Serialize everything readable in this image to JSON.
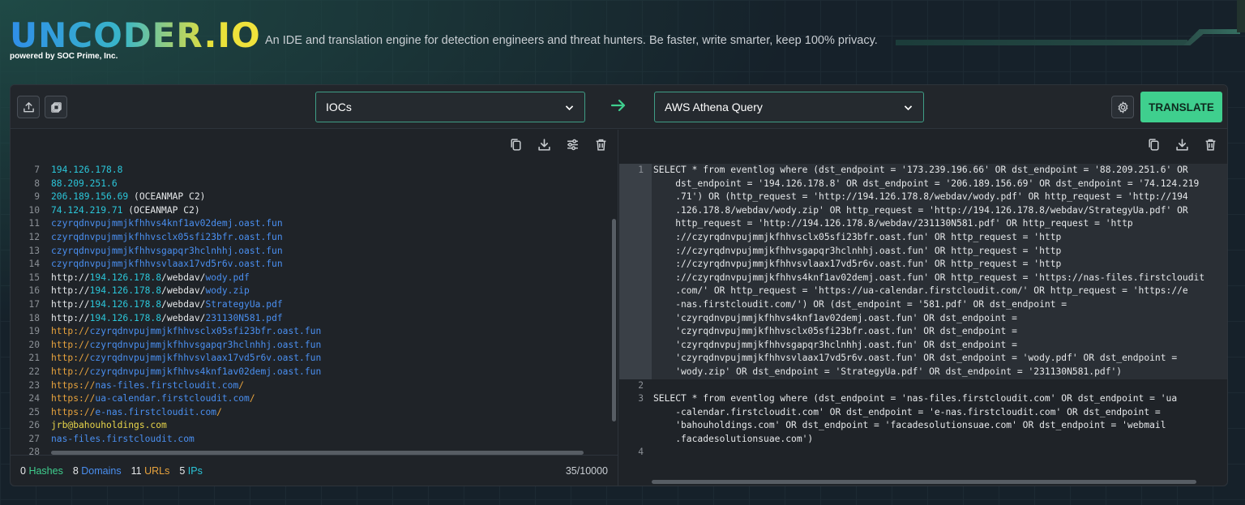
{
  "header": {
    "logo": "UNCODER.IO",
    "powered_by": "powered by SOC Prime, Inc.",
    "tagline": "An IDE and translation engine for detection engineers and threat hunters. Be faster, write smarter, keep 100% privacy."
  },
  "toolbar": {
    "source_select": "IOCs",
    "target_select": "AWS Athena Query",
    "translate_label": "TRANSLATE"
  },
  "left_editor": {
    "lines": [
      {
        "n": "7",
        "segs": [
          {
            "t": "194.126.178.8",
            "c": "ip"
          }
        ]
      },
      {
        "n": "8",
        "segs": [
          {
            "t": "88.209.251.6",
            "c": "ip"
          }
        ]
      },
      {
        "n": "9",
        "segs": [
          {
            "t": "206.189.156.69",
            "c": "ip"
          },
          {
            "t": " (OCEANMAP C2)",
            "c": "plain"
          }
        ]
      },
      {
        "n": "10",
        "segs": [
          {
            "t": "74.124.219.71",
            "c": "ip"
          },
          {
            "t": " (OCEANMAP C2)",
            "c": "plain"
          }
        ]
      },
      {
        "n": "11",
        "segs": [
          {
            "t": "czyrqdnvpujmmjkfhhvs4knf1av02demj.oast.fun",
            "c": "dom"
          }
        ]
      },
      {
        "n": "12",
        "segs": [
          {
            "t": "czyrqdnvpujmmjkfhhvsclx05sfi23bfr.oast.fun",
            "c": "dom"
          }
        ]
      },
      {
        "n": "13",
        "segs": [
          {
            "t": "czyrqdnvpujmmjkfhhvsgapqr3hclnhhj.oast.fun",
            "c": "dom"
          }
        ]
      },
      {
        "n": "14",
        "segs": [
          {
            "t": "czyrqdnvpujmmjkfhhvsvlaax17vd5r6v.oast.fun",
            "c": "dom"
          }
        ]
      },
      {
        "n": "15",
        "segs": [
          {
            "t": "http://",
            "c": "plain"
          },
          {
            "t": "194.126.178.8",
            "c": "ip"
          },
          {
            "t": "/webdav/",
            "c": "plain"
          },
          {
            "t": "wody.pdf",
            "c": "dom"
          }
        ]
      },
      {
        "n": "16",
        "segs": [
          {
            "t": "http://",
            "c": "plain"
          },
          {
            "t": "194.126.178.8",
            "c": "ip"
          },
          {
            "t": "/webdav/",
            "c": "plain"
          },
          {
            "t": "wody.zip",
            "c": "dom"
          }
        ]
      },
      {
        "n": "17",
        "segs": [
          {
            "t": "http://",
            "c": "plain"
          },
          {
            "t": "194.126.178.8",
            "c": "ip"
          },
          {
            "t": "/webdav/",
            "c": "plain"
          },
          {
            "t": "StrategyUa.pdf",
            "c": "dom"
          }
        ]
      },
      {
        "n": "18",
        "segs": [
          {
            "t": "http://",
            "c": "plain"
          },
          {
            "t": "194.126.178.8",
            "c": "ip"
          },
          {
            "t": "/webdav/",
            "c": "plain"
          },
          {
            "t": "231130N581.pdf",
            "c": "dom"
          }
        ]
      },
      {
        "n": "19",
        "segs": [
          {
            "t": "http://",
            "c": "url"
          },
          {
            "t": "czyrqdnvpujmmjkfhhvsclx05sfi23bfr.oast.fun",
            "c": "dom"
          }
        ]
      },
      {
        "n": "20",
        "segs": [
          {
            "t": "http://",
            "c": "url"
          },
          {
            "t": "czyrqdnvpujmmjkfhhvsgapqr3hclnhhj.oast.fun",
            "c": "dom"
          }
        ]
      },
      {
        "n": "21",
        "segs": [
          {
            "t": "http://",
            "c": "url"
          },
          {
            "t": "czyrqdnvpujmmjkfhhvsvlaax17vd5r6v.oast.fun",
            "c": "dom"
          }
        ]
      },
      {
        "n": "22",
        "segs": [
          {
            "t": "http://",
            "c": "url"
          },
          {
            "t": "czyrqdnvpujmmjkfhhvs4knf1av02demj.oast.fun",
            "c": "dom"
          }
        ]
      },
      {
        "n": "23",
        "segs": [
          {
            "t": "https://",
            "c": "url"
          },
          {
            "t": "nas-files.firstcloudit.com",
            "c": "dom"
          },
          {
            "t": "/",
            "c": "url"
          }
        ]
      },
      {
        "n": "24",
        "segs": [
          {
            "t": "https://",
            "c": "url"
          },
          {
            "t": "ua-calendar.firstcloudit.com",
            "c": "dom"
          },
          {
            "t": "/",
            "c": "url"
          }
        ]
      },
      {
        "n": "25",
        "segs": [
          {
            "t": "https://",
            "c": "url"
          },
          {
            "t": "e-nas.firstcloudit.com",
            "c": "dom"
          },
          {
            "t": "/",
            "c": "url"
          }
        ]
      },
      {
        "n": "26",
        "segs": [
          {
            "t": "jrb@bahouholdings.com",
            "c": "mail"
          }
        ]
      },
      {
        "n": "27",
        "segs": [
          {
            "t": "nas-files.firstcloudit.com",
            "c": "dom"
          }
        ]
      },
      {
        "n": "28",
        "segs": [
          {
            "t": "",
            "c": "dom"
          }
        ]
      }
    ]
  },
  "status": {
    "hashes_count": "0",
    "hashes_label": "Hashes",
    "domains_count": "8",
    "domains_label": "Domains",
    "urls_count": "11",
    "urls_label": "URLs",
    "ips_count": "5",
    "ips_label": "IPs",
    "char_count": "35/10000"
  },
  "right_editor": {
    "blocks": [
      {
        "n": "1",
        "lines": [
          "SELECT * from eventlog where (dst_endpoint = '173.239.196.66' OR dst_endpoint = '88.209.251.6' OR",
          "    dst_endpoint = '194.126.178.8' OR dst_endpoint = '206.189.156.69' OR dst_endpoint = '74.124.219",
          "    .71') OR (http_request = 'http://194.126.178.8/webdav/wody.pdf' OR http_request = 'http://194",
          "    .126.178.8/webdav/wody.zip' OR http_request = 'http://194.126.178.8/webdav/StrategyUa.pdf' OR",
          "    http_request = 'http://194.126.178.8/webdav/231130N581.pdf' OR http_request = 'http",
          "    ://czyrqdnvpujmmjkfhhvsclx05sfi23bfr.oast.fun' OR http_request = 'http",
          "    ://czyrqdnvpujmmjkfhhvsgapqr3hclnhhj.oast.fun' OR http_request = 'http",
          "    ://czyrqdnvpujmmjkfhhvsvlaax17vd5r6v.oast.fun' OR http_request = 'http",
          "    ://czyrqdnvpujmmjkfhhvs4knf1av02demj.oast.fun' OR http_request = 'https://nas-files.firstcloudit",
          "    .com/' OR http_request = 'https://ua-calendar.firstcloudit.com/' OR http_request = 'https://e",
          "    -nas.firstcloudit.com/') OR (dst_endpoint = '581.pdf' OR dst_endpoint =",
          "    'czyrqdnvpujmmjkfhhvs4knf1av02demj.oast.fun' OR dst_endpoint =",
          "    'czyrqdnvpujmmjkfhhvsclx05sfi23bfr.oast.fun' OR dst_endpoint =",
          "    'czyrqdnvpujmmjkfhhvsgapqr3hclnhhj.oast.fun' OR dst_endpoint =",
          "    'czyrqdnvpujmmjkfhhvsvlaax17vd5r6v.oast.fun' OR dst_endpoint = 'wody.pdf' OR dst_endpoint =",
          "    'wody.zip' OR dst_endpoint = 'StrategyUa.pdf' OR dst_endpoint = '231130N581.pdf')"
        ]
      },
      {
        "n": "2",
        "lines": [
          ""
        ]
      },
      {
        "n": "3",
        "lines": [
          "SELECT * from eventlog where (dst_endpoint = 'nas-files.firstcloudit.com' OR dst_endpoint = 'ua",
          "    -calendar.firstcloudit.com' OR dst_endpoint = 'e-nas.firstcloudit.com' OR dst_endpoint =",
          "    'bahouholdings.com' OR dst_endpoint = 'facadesolutionsuae.com' OR dst_endpoint = 'webmail",
          "    .facadesolutionsuae.com')"
        ]
      },
      {
        "n": "4",
        "lines": [
          ""
        ]
      }
    ]
  }
}
